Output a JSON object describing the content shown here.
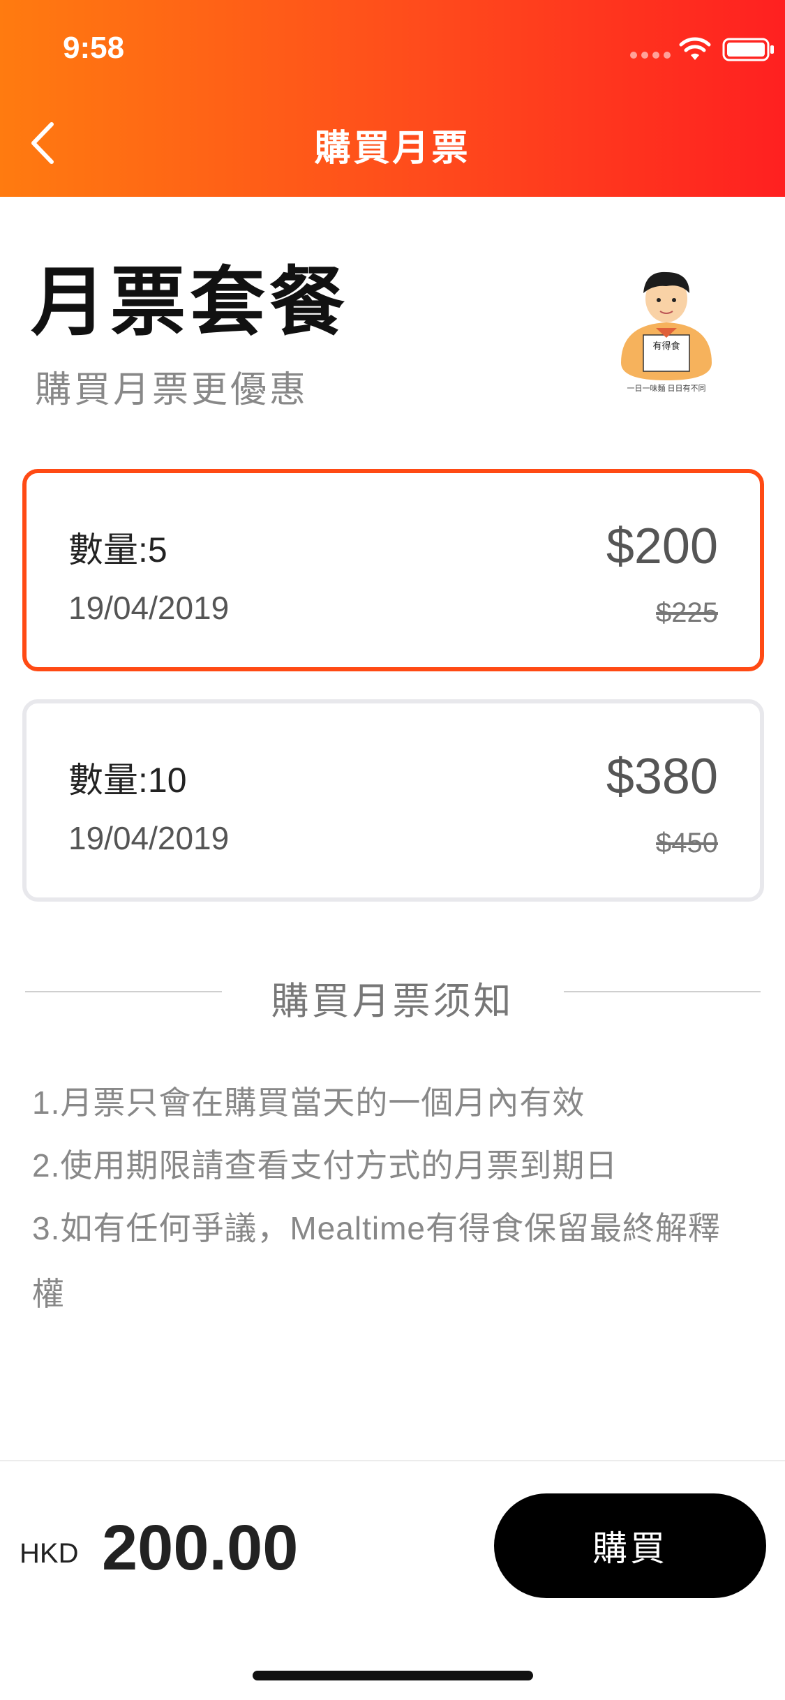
{
  "status_bar": {
    "time": "9:58"
  },
  "nav": {
    "title": "購買月票"
  },
  "page": {
    "title": "月票套餐",
    "subtitle": "購買月票更優惠",
    "mascot_badge": "有得食",
    "mascot_tagline": "一日一味麵 日日有不同"
  },
  "plans": [
    {
      "qty_label": "數量:5",
      "date": "19/04/2019",
      "price": "$200",
      "original_price": "$225",
      "selected": true
    },
    {
      "qty_label": "數量:10",
      "date": "19/04/2019",
      "price": "$380",
      "original_price": "$450",
      "selected": false
    }
  ],
  "notice": {
    "title": "購買月票须知",
    "items": [
      "1.月票只會在購買當天的一個月內有效",
      "2.使用期限請查看支付方式的月票到期日",
      "3.如有任何爭議，Mealtime有得食保留最終解釋",
      "權"
    ]
  },
  "footer": {
    "currency": "HKD",
    "total": "200.00",
    "buy_label": "購買"
  },
  "colors": {
    "accent": "#ff4a14",
    "header_start": "#ff7b10",
    "header_end": "#ff2020"
  }
}
